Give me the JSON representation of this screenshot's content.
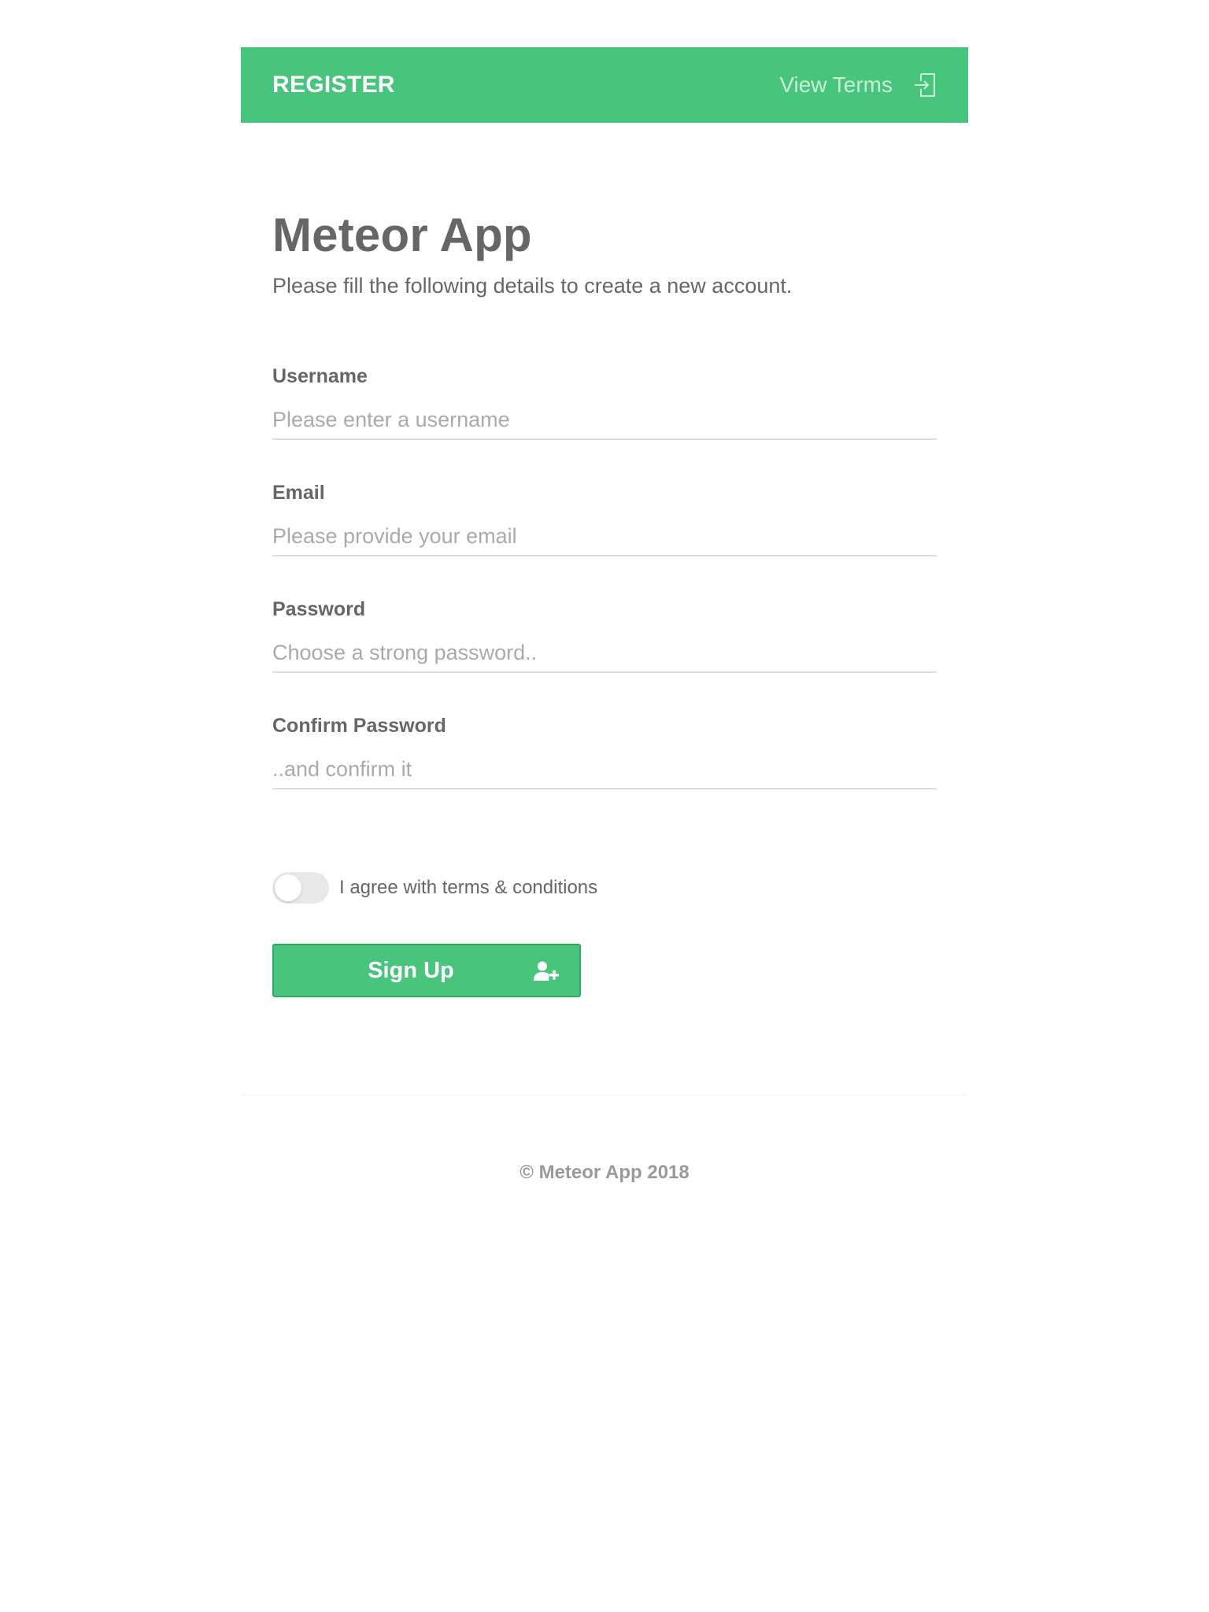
{
  "header": {
    "title": "REGISTER",
    "link_label": "View Terms",
    "link_icon": "sign-in-icon",
    "background": "#48c57c"
  },
  "main": {
    "title": "Meteor App",
    "subtitle": "Please fill the following details to create a new account."
  },
  "form": {
    "fields": [
      {
        "label": "Username",
        "placeholder": "Please enter a username",
        "value": ""
      },
      {
        "label": "Email",
        "placeholder": "Please provide your email",
        "value": ""
      },
      {
        "label": "Password",
        "placeholder": "Choose a strong password..",
        "value": ""
      },
      {
        "label": "Confirm Password",
        "placeholder": "..and confirm it",
        "value": ""
      }
    ],
    "terms_toggle": {
      "label": "I agree with terms & conditions",
      "checked": false
    },
    "submit": {
      "label": "Sign Up",
      "icon": "add-user-icon"
    }
  },
  "footer": {
    "text": "© Meteor App 2018"
  },
  "colors": {
    "accent": "#48c57c",
    "text": "#666666",
    "placeholder": "#aaaaaa"
  }
}
